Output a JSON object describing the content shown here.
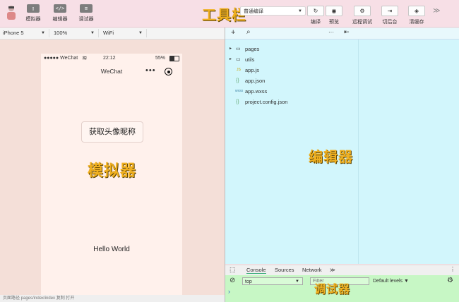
{
  "toolbar": {
    "title": "工具栏",
    "buttons": [
      {
        "icon": "▯",
        "label": "模拟器"
      },
      {
        "icon": "</>",
        "label": "编辑器"
      },
      {
        "icon": "≡",
        "label": "调试器"
      }
    ],
    "compile_mode": "普通编译",
    "right_buttons": [
      {
        "icon": "↻",
        "label": "编译"
      },
      {
        "icon": "◉",
        "label": "预览"
      },
      {
        "icon": "⚙",
        "label": "远程调试"
      },
      {
        "icon": "⇥",
        "label": "切后台"
      },
      {
        "icon": "◈",
        "label": "清缓存"
      }
    ],
    "more": "≫"
  },
  "simulator": {
    "device": "iPhone 5",
    "zoom": "100%",
    "network": "WiFi",
    "status_left": "●●●●● WeChat",
    "status_time": "22:12",
    "status_battery": "55%",
    "nav_title": "WeChat",
    "nav_dots": "•••",
    "button_label": "获取头像昵称",
    "overlay_label": "模拟器",
    "hello": "Hello World",
    "bottom_path": "页面路径   pages/index/index   复制   打开"
  },
  "editor": {
    "overlay_label": "编辑器",
    "add_icon": "+",
    "search_icon": "⌕",
    "more_icon": "···",
    "collapse_icon": "⇤",
    "files": [
      {
        "type": "folder",
        "name": "pages",
        "icon": "▭",
        "caret": "▸"
      },
      {
        "type": "folder",
        "name": "utils",
        "icon": "▭",
        "caret": "▸"
      },
      {
        "type": "js",
        "name": "app.js",
        "icon": "JS"
      },
      {
        "type": "json",
        "name": "app.json",
        "icon": "{}"
      },
      {
        "type": "wxss",
        "name": "app.wxss",
        "icon": "wxss"
      },
      {
        "type": "json",
        "name": "project.config.json",
        "icon": "{}"
      }
    ]
  },
  "debugger": {
    "overlay_label": "调试器",
    "tabs": [
      "Console",
      "Sources",
      "Network"
    ],
    "tabs_more": "≫",
    "context": "top",
    "filter_placeholder": "Filter",
    "levels": "Default levels ▼",
    "prompt": "›"
  },
  "colors": {
    "toolbar_bg": "#f7dfe6",
    "simulator_bg": "#f4dfd8",
    "editor_bg": "#d2f6fc",
    "debugger_bg": "#c7f7c5",
    "label_yellow": "#f0b020"
  }
}
